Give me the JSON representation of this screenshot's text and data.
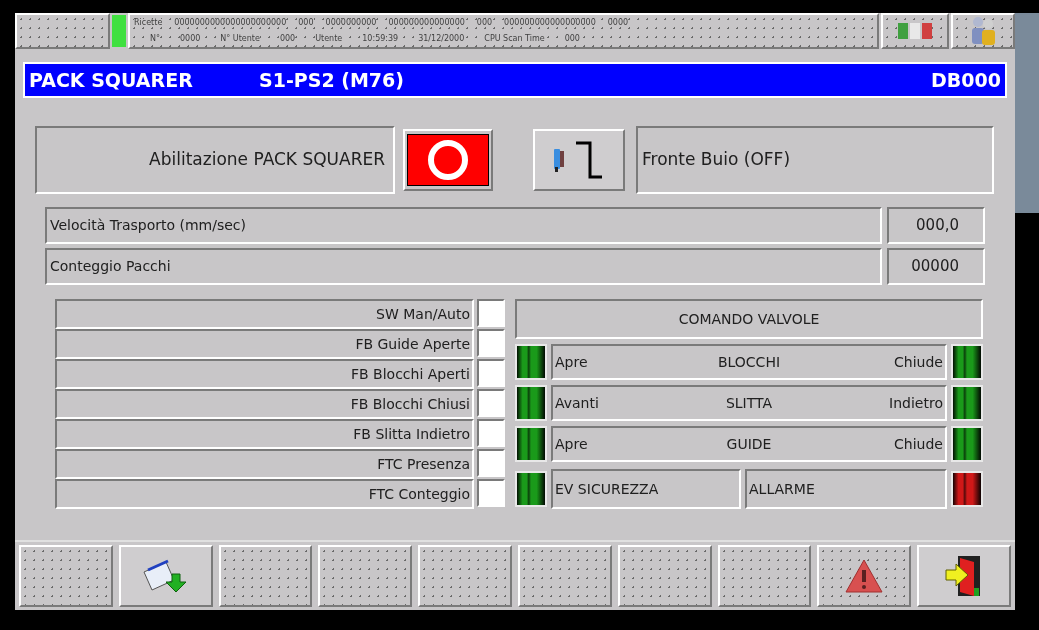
{
  "status_bar": {
    "row_1": [
      "Ricette",
      "0000000000000000000000",
      "000",
      "0000000000",
      "000000000000000",
      "000",
      "000000000000000000",
      "0000"
    ],
    "row_2": [
      "N°",
      "0000",
      "N° Utente",
      "000",
      "Utente",
      "10:59:39",
      "31/12/2000",
      "CPU Scan Time",
      "000"
    ]
  },
  "header": {
    "title": "PACK SQUARER",
    "subtitle": "S1-PS2 (M76)",
    "code": "DB000"
  },
  "enable": {
    "label": "Abilitazione PACK SQUARER",
    "on": false
  },
  "edge": {
    "label": "Fronte Buio (OFF)"
  },
  "measures": [
    {
      "label": "Velocità Trasporto (mm/sec)",
      "value": "000,0"
    },
    {
      "label": "Conteggio Pacchi",
      "value": "00000"
    }
  ],
  "inputs": [
    {
      "label": "SW Man/Auto",
      "checked": false
    },
    {
      "label": "FB Guide Aperte",
      "checked": false
    },
    {
      "label": "FB Blocchi Aperti",
      "checked": false
    },
    {
      "label": "FB Blocchi Chiusi",
      "checked": false
    },
    {
      "label": "FB Slitta Indietro",
      "checked": false
    },
    {
      "label": "FTC Presenza",
      "checked": false
    },
    {
      "label": "FTC Conteggio",
      "checked": false
    }
  ],
  "valves": {
    "title": "COMANDO VALVOLE",
    "rows": [
      {
        "left": "Apre",
        "name": "BLOCCHI",
        "right": "Chiude",
        "lamps": [
          {
            "color": "#1a9a1a"
          },
          {
            "color": "#1a9a1a"
          }
        ]
      },
      {
        "left": "Avanti",
        "name": "SLITTA",
        "right": "Indietro",
        "lamps": [
          {
            "color": "#1a9a1a"
          },
          {
            "color": "#1a9a1a"
          }
        ]
      },
      {
        "left": "Apre",
        "name": "GUIDE",
        "right": "Chiude",
        "lamps": [
          {
            "color": "#1a9a1a"
          },
          {
            "color": "#1a9a1a"
          }
        ]
      }
    ],
    "safety": {
      "label": "EV SICUREZZA",
      "color": "#1a9a1a"
    },
    "alarm": {
      "label": "ALLARME",
      "color": "#d01818"
    }
  },
  "toolbar": [
    {
      "kind": "blank"
    },
    {
      "kind": "download"
    },
    {
      "kind": "blank"
    },
    {
      "kind": "blank"
    },
    {
      "kind": "blank"
    },
    {
      "kind": "blank"
    },
    {
      "kind": "blank"
    },
    {
      "kind": "blank"
    },
    {
      "kind": "alarm"
    },
    {
      "kind": "exit"
    }
  ]
}
